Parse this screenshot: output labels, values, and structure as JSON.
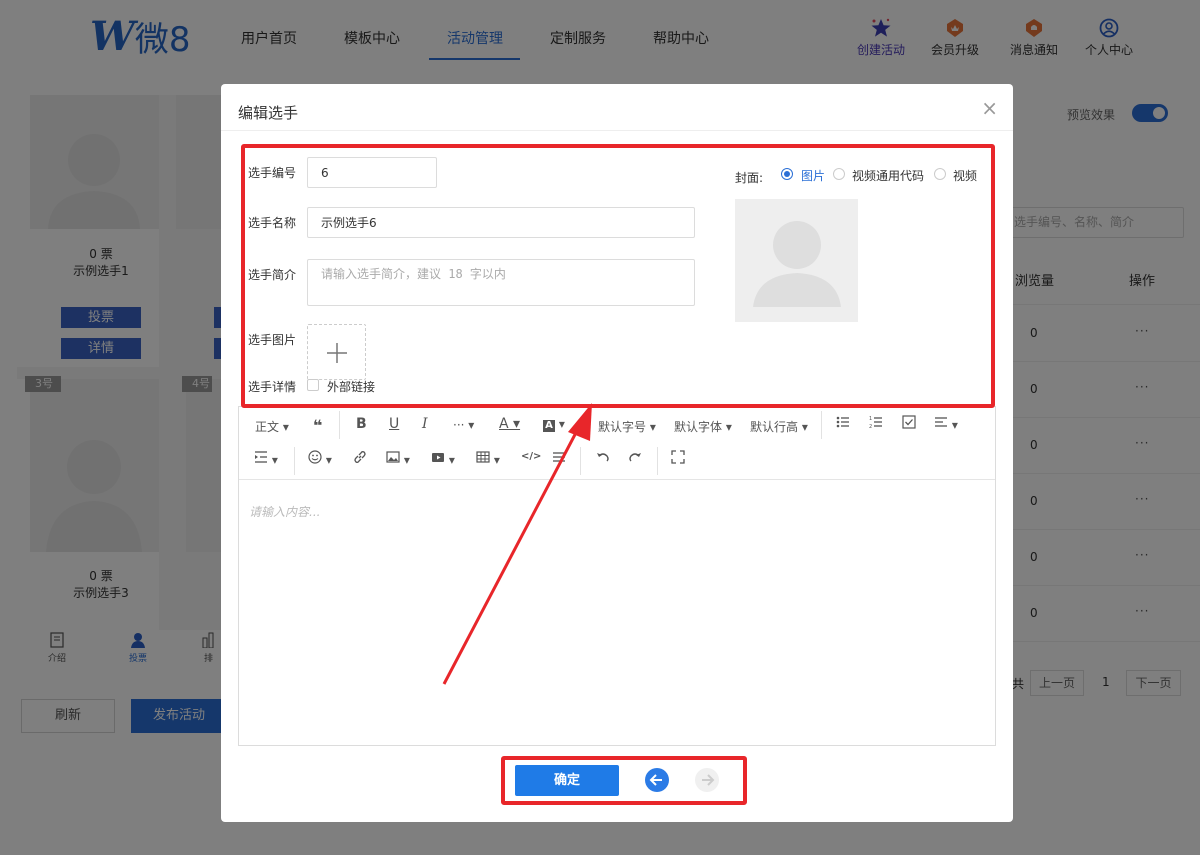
{
  "nav": {
    "logo_text": "微8",
    "items": [
      "用户首页",
      "模板中心",
      "活动管理",
      "定制服务",
      "帮助中心"
    ],
    "active_index": 2,
    "right_items": [
      {
        "label": "创建活动",
        "icon": "star-icon"
      },
      {
        "label": "会员升级",
        "icon": "crown-badge-icon"
      },
      {
        "label": "消息通知",
        "icon": "bell-badge-icon"
      },
      {
        "label": "个人中心",
        "icon": "user-circle-icon"
      }
    ]
  },
  "background": {
    "cards": [
      {
        "votes": "0 票",
        "name": "示例选手1",
        "vote_btn": "投票",
        "detail_btn": "详情"
      },
      {
        "votes": "0 票",
        "name": "示例选手3",
        "number": "3号"
      }
    ],
    "card2_number": "4号",
    "bottom_tabs": [
      "介绍",
      "投票",
      "排"
    ],
    "refresh_btn": "刷新",
    "publish_btn": "发布活动",
    "preview_label": "预览效果",
    "search_placeholder": "选手编号、名称、简介",
    "table_headers": {
      "views": "浏览量",
      "actions": "操作"
    },
    "table_rows": [
      "0",
      "0",
      "0",
      "0",
      "0",
      "0"
    ],
    "row_action": "···",
    "pagination": {
      "prev": "上一页",
      "page": "1",
      "next": "下一页",
      "left_fragment": "共"
    }
  },
  "modal": {
    "title": "编辑选手",
    "close": "×",
    "fields": {
      "number_label": "选手编号",
      "number_value": "6",
      "name_label": "选手名称",
      "name_value": "示例选手6",
      "intro_label": "选手简介",
      "intro_placeholder": "请输入选手简介，建议 18 字以内",
      "image_label": "选手图片",
      "detail_label": "选手详情",
      "external_link_label": "外部链接"
    },
    "cover": {
      "label": "封面:",
      "options": [
        "图片",
        "视频通用代码",
        "视频"
      ],
      "selected_index": 0
    },
    "toolbar_row1": [
      "正文",
      "❝",
      "B",
      "U",
      "I",
      "···",
      "A",
      "A",
      "默认字号",
      "默认字体",
      "默认行高",
      "bulleted-list",
      "numbered-list",
      "checklist",
      "align"
    ],
    "toolbar_row1_labels": {
      "heading": "正文",
      "font_size": "默认字号",
      "font_family": "默认字体",
      "line_height": "默认行高"
    },
    "editor_placeholder": "请输入内容...",
    "confirm_btn": "确定"
  },
  "colors": {
    "brand": "#2b6fd6",
    "annotation_red": "#e8262a",
    "card_button": "#3a63c4"
  }
}
